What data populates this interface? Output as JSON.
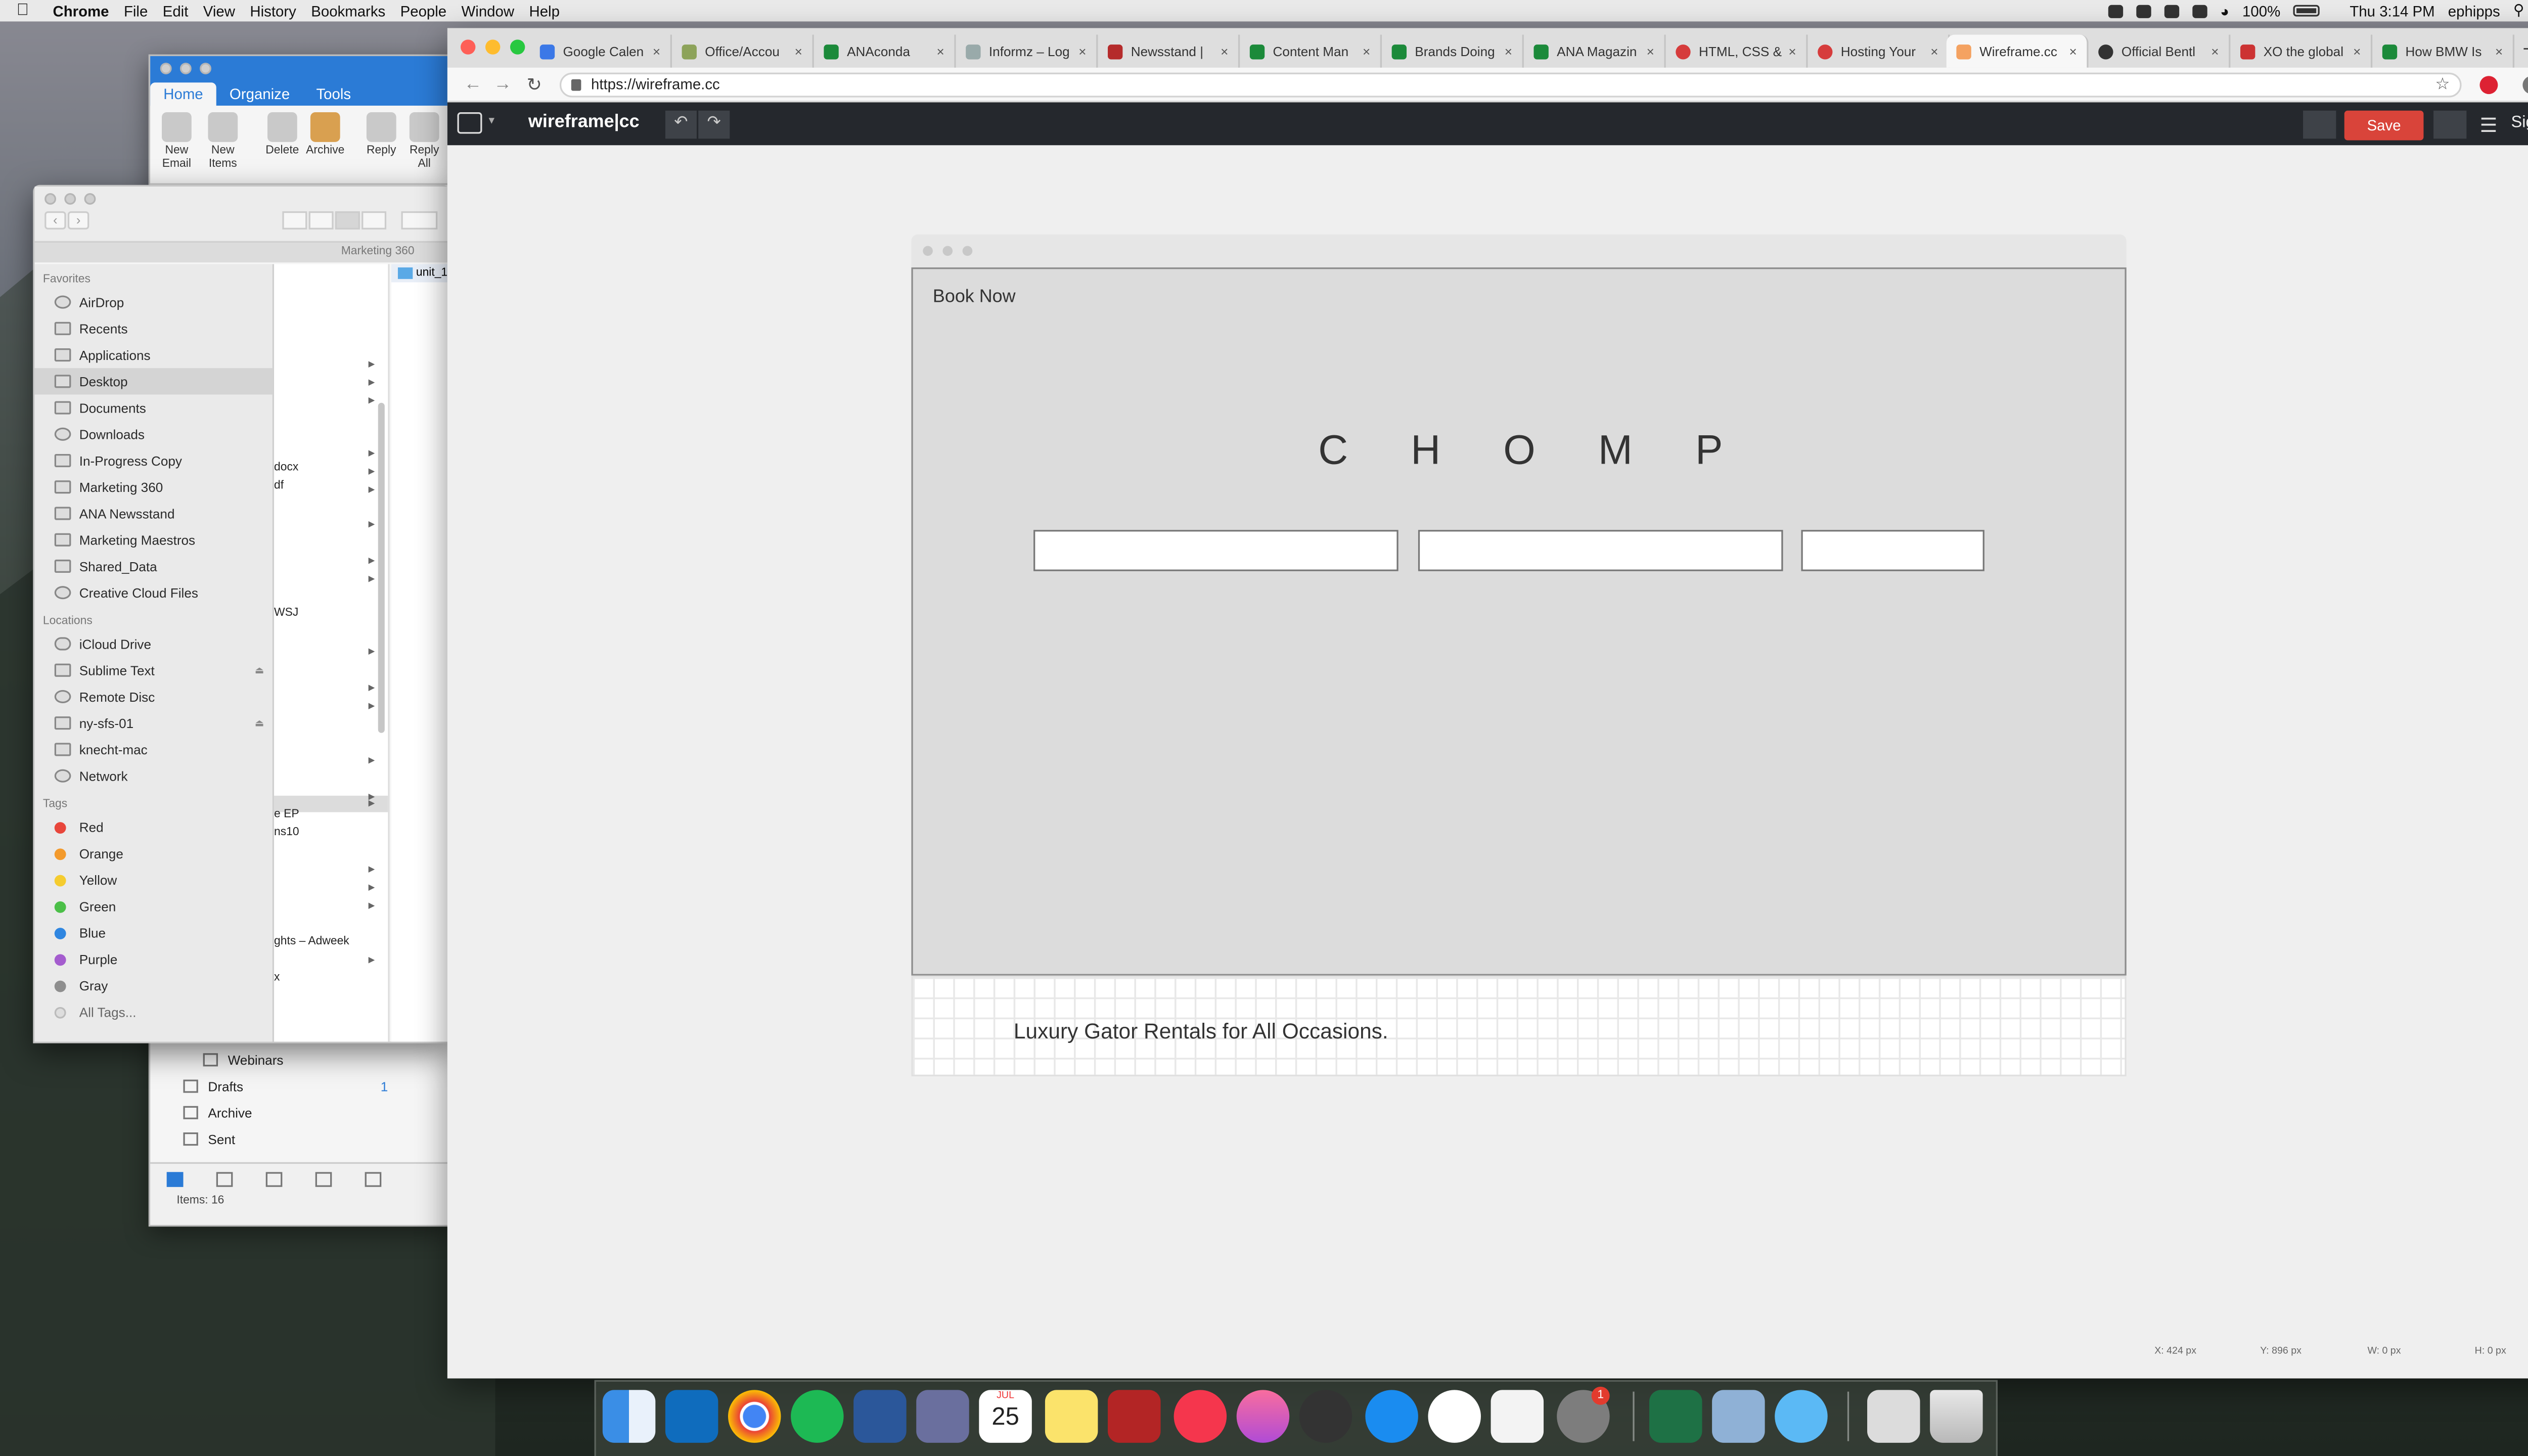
{
  "menubar": {
    "app": "Chrome",
    "items": [
      "File",
      "Edit",
      "View",
      "History",
      "Bookmarks",
      "People",
      "Window",
      "Help"
    ],
    "battery": "100%",
    "clock": "Thu 3:14 PM",
    "user": "ephipps"
  },
  "outlook": {
    "tabs": [
      "Home",
      "Organize",
      "Tools"
    ],
    "ribbon": {
      "new_email": "New\nEmail",
      "new_items": "New\nItems",
      "delete": "Delete",
      "archive": "Archive",
      "reply": "Reply",
      "reply_all": "Reply\nAll"
    },
    "folders": [
      {
        "label": "Webinars",
        "count": ""
      },
      {
        "label": "Drafts",
        "count": "1"
      },
      {
        "label": "Archive",
        "count": ""
      },
      {
        "label": "Sent",
        "count": ""
      }
    ],
    "status": "Items: 16"
  },
  "finder": {
    "path": "Marketing 360",
    "favorites_heading": "Favorites",
    "favorites": [
      "AirDrop",
      "Recents",
      "Applications",
      "Desktop",
      "Documents",
      "Downloads",
      "In-Progress Copy",
      "Marketing 360",
      "ANA Newsstand",
      "Marketing Maestros",
      "Shared_Data",
      "Creative Cloud Files"
    ],
    "locations_heading": "Locations",
    "locations": [
      "iCloud Drive",
      "Sublime Text",
      "Remote Disc",
      "ny-sfs-01",
      "knecht-mac",
      "Network"
    ],
    "tags_heading": "Tags",
    "tags": [
      {
        "label": "Red",
        "color": "#e8463b"
      },
      {
        "label": "Orange",
        "color": "#f39a2c"
      },
      {
        "label": "Yellow",
        "color": "#f5cc2f"
      },
      {
        "label": "Green",
        "color": "#4bbf48"
      },
      {
        "label": "Blue",
        "color": "#2f86e0"
      },
      {
        "label": "Purple",
        "color": "#a45cce"
      },
      {
        "label": "Gray",
        "color": "#8e8e8e"
      },
      {
        "label": "All Tags...",
        "color": ""
      }
    ],
    "column_fragments": [
      "docx",
      "df",
      "WSJ",
      "e EP",
      "ns10",
      "ghts – Adweek",
      "x"
    ],
    "folder_item": "unit_1"
  },
  "chrome": {
    "tabs": [
      "Google Calen",
      "Office/Accou",
      "ANAconda",
      "Informz – Log",
      "Newsstand |",
      "Content Man",
      "Brands Doing",
      "ANA Magazin",
      "HTML, CSS &",
      "Hosting Your",
      "Wireframe.cc",
      "Official Bentl",
      "XO the global",
      "How BMW Is"
    ],
    "active_tab_index": 10,
    "url": "https://wireframe.cc"
  },
  "wireframe": {
    "logo": "wireframe|cc",
    "save": "Save",
    "signup": "Sign Up",
    "book_now": "Book Now",
    "brand": "CHOMP",
    "tagline": "Luxury Gator Rentals for All Occasions.",
    "coords": {
      "x": "X: 424 px",
      "y": "Y: 896 px",
      "w": "W: 0 px",
      "h": "H: 0 px"
    }
  },
  "dock": {
    "apps": [
      "Finder",
      "Outlook",
      "Chrome",
      "Spotify",
      "Word",
      "BBEdit",
      "Calendar",
      "Notes",
      "Photo Booth",
      "News",
      "iTunes",
      "Alfred",
      "App Store",
      "Slack",
      "TextEdit",
      "System Preferences",
      "Excel",
      "Preview",
      "Messages",
      "Downloads",
      "Trash"
    ],
    "sysprefs_badge": "1",
    "calendar_month": "JUL",
    "calendar_day": "25"
  },
  "colors": {
    "accent_save": "#d9443a",
    "wf_bar": "#25282d"
  }
}
